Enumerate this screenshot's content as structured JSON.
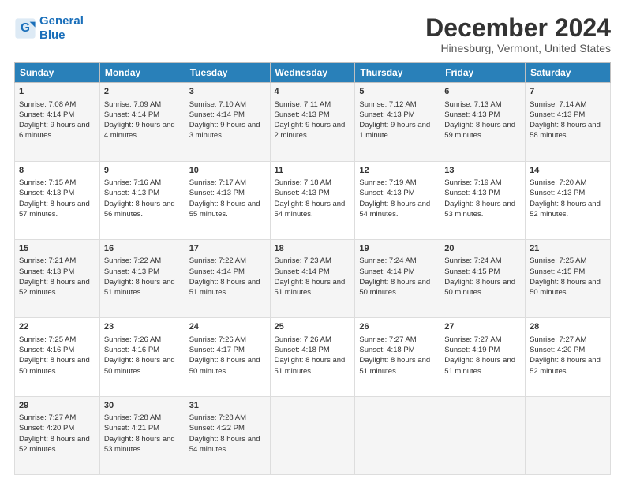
{
  "logo": {
    "line1": "General",
    "line2": "Blue"
  },
  "title": "December 2024",
  "subtitle": "Hinesburg, Vermont, United States",
  "days_of_week": [
    "Sunday",
    "Monday",
    "Tuesday",
    "Wednesday",
    "Thursday",
    "Friday",
    "Saturday"
  ],
  "weeks": [
    [
      {
        "day": 1,
        "lines": [
          "Sunrise: 7:08 AM",
          "Sunset: 4:14 PM",
          "Daylight: 9 hours",
          "and 6 minutes."
        ]
      },
      {
        "day": 2,
        "lines": [
          "Sunrise: 7:09 AM",
          "Sunset: 4:14 PM",
          "Daylight: 9 hours",
          "and 4 minutes."
        ]
      },
      {
        "day": 3,
        "lines": [
          "Sunrise: 7:10 AM",
          "Sunset: 4:14 PM",
          "Daylight: 9 hours",
          "and 3 minutes."
        ]
      },
      {
        "day": 4,
        "lines": [
          "Sunrise: 7:11 AM",
          "Sunset: 4:13 PM",
          "Daylight: 9 hours",
          "and 2 minutes."
        ]
      },
      {
        "day": 5,
        "lines": [
          "Sunrise: 7:12 AM",
          "Sunset: 4:13 PM",
          "Daylight: 9 hours",
          "and 1 minute."
        ]
      },
      {
        "day": 6,
        "lines": [
          "Sunrise: 7:13 AM",
          "Sunset: 4:13 PM",
          "Daylight: 8 hours",
          "and 59 minutes."
        ]
      },
      {
        "day": 7,
        "lines": [
          "Sunrise: 7:14 AM",
          "Sunset: 4:13 PM",
          "Daylight: 8 hours",
          "and 58 minutes."
        ]
      }
    ],
    [
      {
        "day": 8,
        "lines": [
          "Sunrise: 7:15 AM",
          "Sunset: 4:13 PM",
          "Daylight: 8 hours",
          "and 57 minutes."
        ]
      },
      {
        "day": 9,
        "lines": [
          "Sunrise: 7:16 AM",
          "Sunset: 4:13 PM",
          "Daylight: 8 hours",
          "and 56 minutes."
        ]
      },
      {
        "day": 10,
        "lines": [
          "Sunrise: 7:17 AM",
          "Sunset: 4:13 PM",
          "Daylight: 8 hours",
          "and 55 minutes."
        ]
      },
      {
        "day": 11,
        "lines": [
          "Sunrise: 7:18 AM",
          "Sunset: 4:13 PM",
          "Daylight: 8 hours",
          "and 54 minutes."
        ]
      },
      {
        "day": 12,
        "lines": [
          "Sunrise: 7:19 AM",
          "Sunset: 4:13 PM",
          "Daylight: 8 hours",
          "and 54 minutes."
        ]
      },
      {
        "day": 13,
        "lines": [
          "Sunrise: 7:19 AM",
          "Sunset: 4:13 PM",
          "Daylight: 8 hours",
          "and 53 minutes."
        ]
      },
      {
        "day": 14,
        "lines": [
          "Sunrise: 7:20 AM",
          "Sunset: 4:13 PM",
          "Daylight: 8 hours",
          "and 52 minutes."
        ]
      }
    ],
    [
      {
        "day": 15,
        "lines": [
          "Sunrise: 7:21 AM",
          "Sunset: 4:13 PM",
          "Daylight: 8 hours",
          "and 52 minutes."
        ]
      },
      {
        "day": 16,
        "lines": [
          "Sunrise: 7:22 AM",
          "Sunset: 4:13 PM",
          "Daylight: 8 hours",
          "and 51 minutes."
        ]
      },
      {
        "day": 17,
        "lines": [
          "Sunrise: 7:22 AM",
          "Sunset: 4:14 PM",
          "Daylight: 8 hours",
          "and 51 minutes."
        ]
      },
      {
        "day": 18,
        "lines": [
          "Sunrise: 7:23 AM",
          "Sunset: 4:14 PM",
          "Daylight: 8 hours",
          "and 51 minutes."
        ]
      },
      {
        "day": 19,
        "lines": [
          "Sunrise: 7:24 AM",
          "Sunset: 4:14 PM",
          "Daylight: 8 hours",
          "and 50 minutes."
        ]
      },
      {
        "day": 20,
        "lines": [
          "Sunrise: 7:24 AM",
          "Sunset: 4:15 PM",
          "Daylight: 8 hours",
          "and 50 minutes."
        ]
      },
      {
        "day": 21,
        "lines": [
          "Sunrise: 7:25 AM",
          "Sunset: 4:15 PM",
          "Daylight: 8 hours",
          "and 50 minutes."
        ]
      }
    ],
    [
      {
        "day": 22,
        "lines": [
          "Sunrise: 7:25 AM",
          "Sunset: 4:16 PM",
          "Daylight: 8 hours",
          "and 50 minutes."
        ]
      },
      {
        "day": 23,
        "lines": [
          "Sunrise: 7:26 AM",
          "Sunset: 4:16 PM",
          "Daylight: 8 hours",
          "and 50 minutes."
        ]
      },
      {
        "day": 24,
        "lines": [
          "Sunrise: 7:26 AM",
          "Sunset: 4:17 PM",
          "Daylight: 8 hours",
          "and 50 minutes."
        ]
      },
      {
        "day": 25,
        "lines": [
          "Sunrise: 7:26 AM",
          "Sunset: 4:18 PM",
          "Daylight: 8 hours",
          "and 51 minutes."
        ]
      },
      {
        "day": 26,
        "lines": [
          "Sunrise: 7:27 AM",
          "Sunset: 4:18 PM",
          "Daylight: 8 hours",
          "and 51 minutes."
        ]
      },
      {
        "day": 27,
        "lines": [
          "Sunrise: 7:27 AM",
          "Sunset: 4:19 PM",
          "Daylight: 8 hours",
          "and 51 minutes."
        ]
      },
      {
        "day": 28,
        "lines": [
          "Sunrise: 7:27 AM",
          "Sunset: 4:20 PM",
          "Daylight: 8 hours",
          "and 52 minutes."
        ]
      }
    ],
    [
      {
        "day": 29,
        "lines": [
          "Sunrise: 7:27 AM",
          "Sunset: 4:20 PM",
          "Daylight: 8 hours",
          "and 52 minutes."
        ]
      },
      {
        "day": 30,
        "lines": [
          "Sunrise: 7:28 AM",
          "Sunset: 4:21 PM",
          "Daylight: 8 hours",
          "and 53 minutes."
        ]
      },
      {
        "day": 31,
        "lines": [
          "Sunrise: 7:28 AM",
          "Sunset: 4:22 PM",
          "Daylight: 8 hours",
          "and 54 minutes."
        ]
      },
      null,
      null,
      null,
      null
    ]
  ]
}
